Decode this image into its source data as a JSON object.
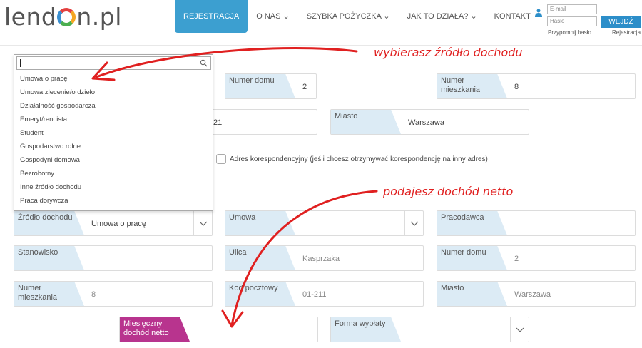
{
  "header": {
    "logo": {
      "part1": "lend",
      "part2": "n.pl"
    },
    "nav": [
      "REJESTRACJA",
      "O NAS",
      "SZYBKA POŻYCZKA",
      "JAK TO DZIAŁA?",
      "KONTAKT"
    ],
    "login": {
      "email_placeholder": "E-mail",
      "password_placeholder": "Hasło",
      "button": "WEJDŹ",
      "forgot": "Przypomnij hasło",
      "register": "Rejestracja"
    }
  },
  "dropdown": {
    "search_value": "",
    "options": [
      "Umowa o pracę",
      "Umowa zlecenie/o dzieło",
      "Działalność gospodarcza",
      "Emeryt/rencista",
      "Student",
      "Gospodarstwo rolne",
      "Gospodyni domowa",
      "Bezrobotny",
      "Inne źródło dochodu",
      "Praca dorywcza"
    ]
  },
  "address_top": {
    "numer_domu": {
      "label": "Numer domu",
      "value": "2"
    },
    "numer_mieszkania": {
      "label": "Numer mieszkania",
      "value": "8"
    },
    "kod_partial": "21",
    "miasto": {
      "label": "Miasto",
      "value": "Warszawa"
    }
  },
  "checkbox_label": "Adres korespondencyjny (jeśli chcesz otrzymywać korespondencję na inny adres)",
  "income": {
    "zrodlo": {
      "label": "Źródło dochodu",
      "value": "Umowa o pracę"
    },
    "umowa": {
      "label": "Umowa",
      "value": ""
    },
    "pracodawca": {
      "label": "Pracodawca",
      "value": ""
    },
    "stanowisko": {
      "label": "Stanowisko",
      "value": ""
    },
    "ulica": {
      "label": "Ulica",
      "value": "Kasprzaka"
    },
    "numer_domu": {
      "label": "Numer domu",
      "value": "2"
    },
    "numer_mieszkania": {
      "label": "Numer mieszkania",
      "value": "8"
    },
    "kod_pocztowy": {
      "label": "Kod pocztowy",
      "value": "01-211"
    },
    "miasto": {
      "label": "Miasto",
      "value": "Warszawa"
    },
    "dochod": {
      "label": "Miesięczny dochód netto",
      "value": ""
    },
    "forma_wyplaty": {
      "label": "Forma wypłaty",
      "value": ""
    }
  },
  "annotations": {
    "top": "wybierasz źródło dochodu",
    "middle": "podajesz dochód netto"
  },
  "colors": {
    "nav_active": "#3c9fd0",
    "label_bg": "#dcebf5",
    "highlight_label": "#b8348e",
    "annotation": "#e02020",
    "button": "#2c8ec9"
  }
}
